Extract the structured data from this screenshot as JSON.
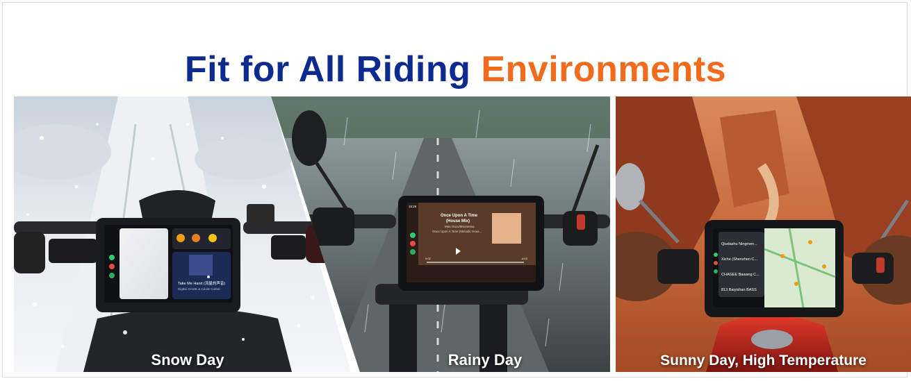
{
  "headline": {
    "part1": "Fit for All Riding",
    "part2": "Environments"
  },
  "panels": [
    {
      "caption": "Snow Day",
      "screen": {
        "now_playing_title": "Take Me Hand (流星的声音)",
        "now_playing_artist": "DigBoi DAISE & Cécile Corbel"
      }
    },
    {
      "caption": "Rainy Day",
      "screen": {
        "time": "16:26",
        "song_title_line1": "Once Upon A Time",
        "song_title_line2": "(House Mix)",
        "artist": "Max Oazo/Moonessa",
        "album": "Once Upon A Time (Melodic Hous...",
        "elapsed": "0:02",
        "remaining": "-4:10"
      }
    },
    {
      "caption": "Sunny Day, High Temperature",
      "screen": {
        "list": [
          "Qiudashu Ningmen...",
          "Xiche (Shenzhen C...",
          "CHAGEE Bawang C...",
          "813 Baiyishan BASS"
        ]
      }
    }
  ],
  "colors": {
    "headline_blue": "#0d2a8f",
    "headline_orange": "#f26b1d"
  }
}
